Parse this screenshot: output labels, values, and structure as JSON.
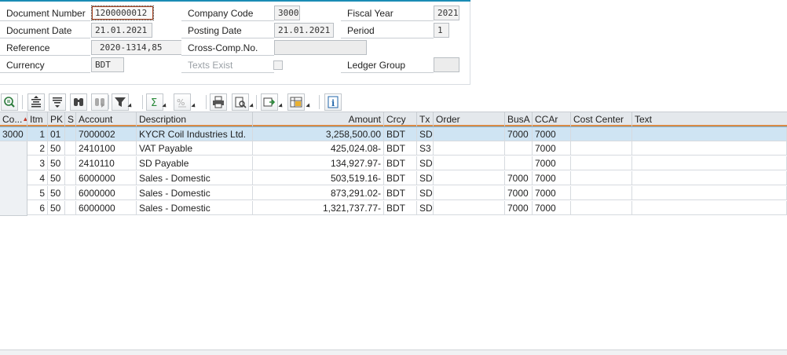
{
  "header": {
    "document_number": {
      "label": "Document Number",
      "value": "1200000012"
    },
    "company_code": {
      "label": "Company Code",
      "value": "3000"
    },
    "fiscal_year": {
      "label": "Fiscal Year",
      "value": "2021"
    },
    "document_date": {
      "label": "Document Date",
      "value": "21.01.2021"
    },
    "posting_date": {
      "label": "Posting Date",
      "value": "21.01.2021"
    },
    "period": {
      "label": "Period",
      "value": "1"
    },
    "reference": {
      "label": "Reference",
      "value": "2020-1314,85"
    },
    "cross_comp": {
      "label": "Cross-Comp.No.",
      "value": ""
    },
    "currency": {
      "label": "Currency",
      "value": "BDT"
    },
    "texts_exist": {
      "label": "Texts Exist",
      "checked": false
    },
    "ledger_group": {
      "label": "Ledger Group",
      "value": ""
    }
  },
  "toolbar": {
    "buttons": [
      "details-icon",
      "sort-ascending-icon",
      "sort-descending-icon",
      "find-icon",
      "find-next-icon",
      "filter-icon",
      "sum-icon",
      "subtotals-icon",
      "print-icon",
      "print-preview-icon",
      "export-icon",
      "layout-icon",
      "info-icon"
    ]
  },
  "table": {
    "columns": [
      "Co...",
      "Itm",
      "PK",
      "S",
      "Account",
      "Description",
      "Amount",
      "Crcy",
      "Tx",
      "Order",
      "BusA",
      "CCAr",
      "Cost Center",
      "Text"
    ],
    "company_code": "3000",
    "rows": [
      {
        "itm": "1",
        "pk": "01",
        "s": "",
        "account": "7000002",
        "description": "KYCR Coil Industries Ltd.",
        "amount": "3,258,500.00",
        "crcy": "BDT",
        "tx": "SD",
        "order": "",
        "busa": "7000",
        "ccar": "7000",
        "cost_center": "",
        "text": ""
      },
      {
        "itm": "2",
        "pk": "50",
        "s": "",
        "account": "2410100",
        "description": "VAT Payable",
        "amount": "425,024.08-",
        "crcy": "BDT",
        "tx": "S3",
        "order": "",
        "busa": "",
        "ccar": "7000",
        "cost_center": "",
        "text": ""
      },
      {
        "itm": "3",
        "pk": "50",
        "s": "",
        "account": "2410110",
        "description": "SD Payable",
        "amount": "134,927.97-",
        "crcy": "BDT",
        "tx": "SD",
        "order": "",
        "busa": "",
        "ccar": "7000",
        "cost_center": "",
        "text": ""
      },
      {
        "itm": "4",
        "pk": "50",
        "s": "",
        "account": "6000000",
        "description": "Sales - Domestic",
        "amount": "503,519.16-",
        "crcy": "BDT",
        "tx": "SD",
        "order": "",
        "busa": "7000",
        "ccar": "7000",
        "cost_center": "",
        "text": ""
      },
      {
        "itm": "5",
        "pk": "50",
        "s": "",
        "account": "6000000",
        "description": "Sales - Domestic",
        "amount": "873,291.02-",
        "crcy": "BDT",
        "tx": "SD",
        "order": "",
        "busa": "7000",
        "ccar": "7000",
        "cost_center": "",
        "text": ""
      },
      {
        "itm": "6",
        "pk": "50",
        "s": "",
        "account": "6000000",
        "description": "Sales - Domestic",
        "amount": "1,321,737.77-",
        "crcy": "BDT",
        "tx": "SD",
        "order": "",
        "busa": "7000",
        "ccar": "7000",
        "cost_center": "",
        "text": ""
      }
    ]
  },
  "colors": {
    "accent": "#1a8cb5",
    "header_separator": "#d98a45",
    "selected_row": "#cfe4f3"
  }
}
